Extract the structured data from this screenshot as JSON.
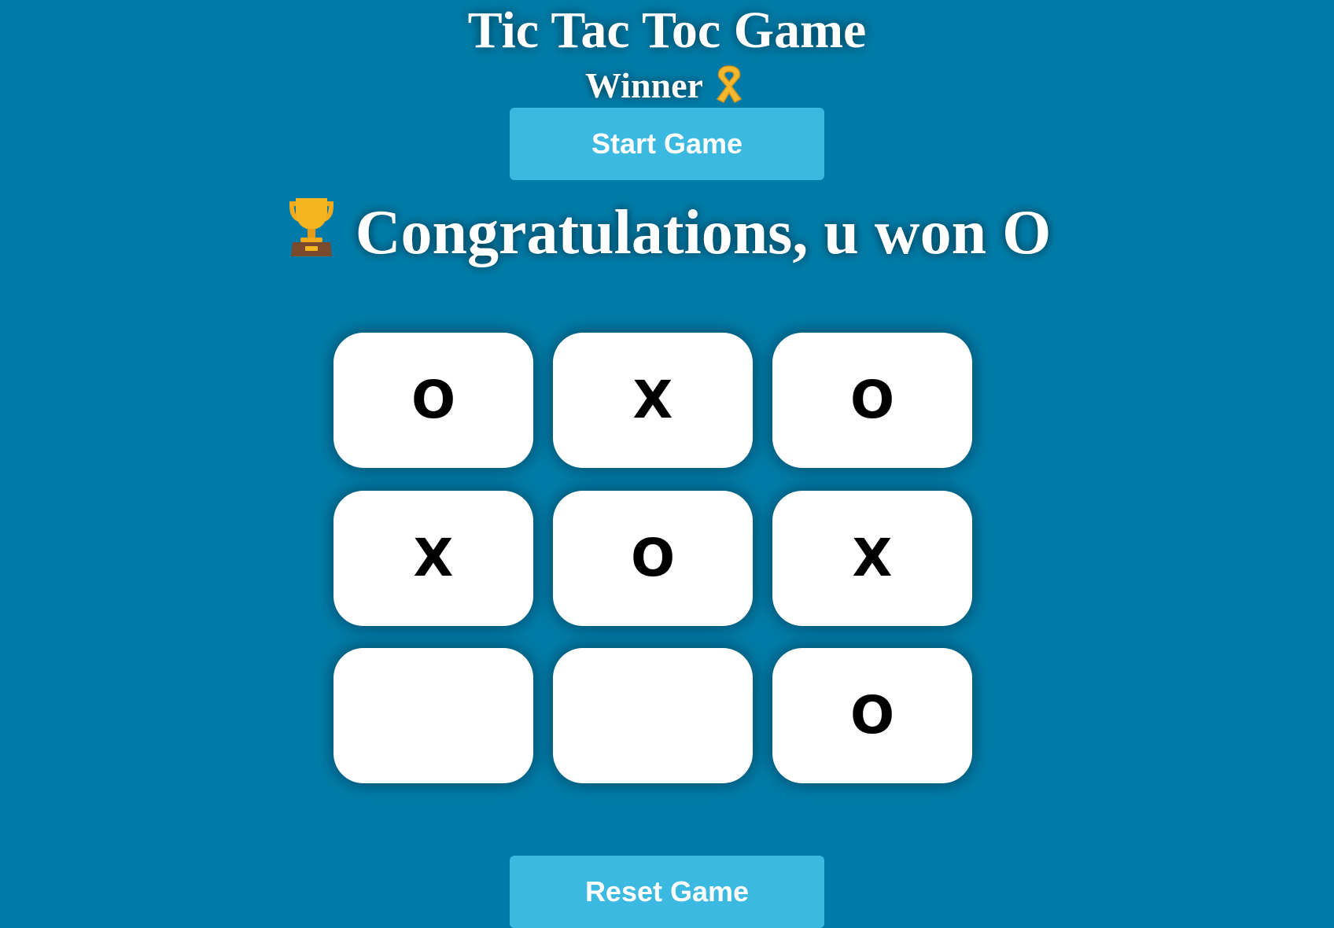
{
  "header": {
    "title": "Tic Tac Toc Game",
    "subtitle": "Winner"
  },
  "icons": {
    "ribbon": "ribbon-icon",
    "trophy": "trophy-icon"
  },
  "buttons": {
    "start_label": "Start Game",
    "reset_label": "Reset Game"
  },
  "message": {
    "text": "Congratulations, u won O"
  },
  "board": {
    "cells": [
      "O",
      "X",
      "O",
      "X",
      "O",
      "X",
      "",
      "",
      "O"
    ]
  },
  "colors": {
    "background": "#007ba7",
    "button": "#3bb9e1",
    "cell": "#ffffff"
  }
}
